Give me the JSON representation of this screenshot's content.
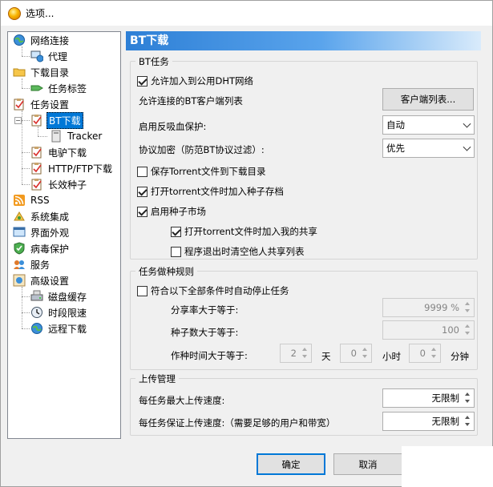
{
  "window": {
    "title": "选项..."
  },
  "tree": {
    "items": [
      {
        "label": "网络连接",
        "icon": "network-globe-icon"
      },
      {
        "label": "代理",
        "icon": "proxy-computer-icon"
      },
      {
        "label": "下载目录",
        "icon": "folder-icon"
      },
      {
        "label": "任务标签",
        "icon": "tag-icon"
      },
      {
        "label": "任务设置",
        "icon": "clipboard-icon"
      },
      {
        "label": "BT下载",
        "icon": "clipboard-icon"
      },
      {
        "label": "Tracker",
        "icon": "tracker-icon"
      },
      {
        "label": "电驴下载",
        "icon": "clipboard-icon"
      },
      {
        "label": "HTTP/FTP下载",
        "icon": "clipboard-icon"
      },
      {
        "label": "长效种子",
        "icon": "clipboard-icon"
      },
      {
        "label": "RSS",
        "icon": "rss-icon"
      },
      {
        "label": "系统集成",
        "icon": "integration-icon"
      },
      {
        "label": "界面外观",
        "icon": "appearance-icon"
      },
      {
        "label": "病毒保护",
        "icon": "shield-icon"
      },
      {
        "label": "服务",
        "icon": "service-icon"
      },
      {
        "label": "高级设置",
        "icon": "advanced-icon"
      },
      {
        "label": "磁盘缓存",
        "icon": "disk-icon"
      },
      {
        "label": "时段限速",
        "icon": "clock-icon"
      },
      {
        "label": "远程下载",
        "icon": "remote-globe-icon"
      }
    ]
  },
  "panel": {
    "header": "BT下载",
    "bt_group": {
      "title": "BT任务",
      "dht_label": "允许加入到公用DHT网络",
      "dht_checked": true,
      "clients_label": "允许连接的BT客户端列表",
      "clients_button": "客户端列表...",
      "anti_leech_label": "启用反吸血保护:",
      "anti_leech_value": "自动",
      "encrypt_label": "协议加密（防范BT协议过滤）:",
      "encrypt_value": "优先",
      "save_torrent_label": "保存Torrent文件到下载目录",
      "save_torrent_checked": false,
      "add_archive_label": "打开torrent文件时加入种子存档",
      "add_archive_checked": true,
      "market_label": "启用种子市场",
      "market_checked": true,
      "share_label": "打开torrent文件时加入我的共享",
      "share_checked": true,
      "clear_label": "程序退出时清空他人共享列表",
      "clear_checked": false
    },
    "seed_group": {
      "title": "任务做种规则",
      "auto_stop_label": "符合以下全部条件时自动停止任务",
      "auto_stop_checked": false,
      "ratio_label": "分享率大于等于:",
      "ratio_value": "9999 %",
      "seeds_label": "种子数大于等于:",
      "seeds_value": "100",
      "time_label": "作种时间大于等于:",
      "days_value": "2",
      "days_unit": "天",
      "hours_value": "0",
      "hours_unit": "小时",
      "minutes_value": "0",
      "minutes_unit": "分钟"
    },
    "upload_group": {
      "title": "上传管理",
      "max_label": "每任务最大上传速度:",
      "max_value": "无限制",
      "guarantee_label": "每任务保证上传速度:（需要足够的用户和带宽）",
      "guarantee_value": "无限制"
    }
  },
  "footer": {
    "ok": "确定",
    "cancel": "取消"
  }
}
